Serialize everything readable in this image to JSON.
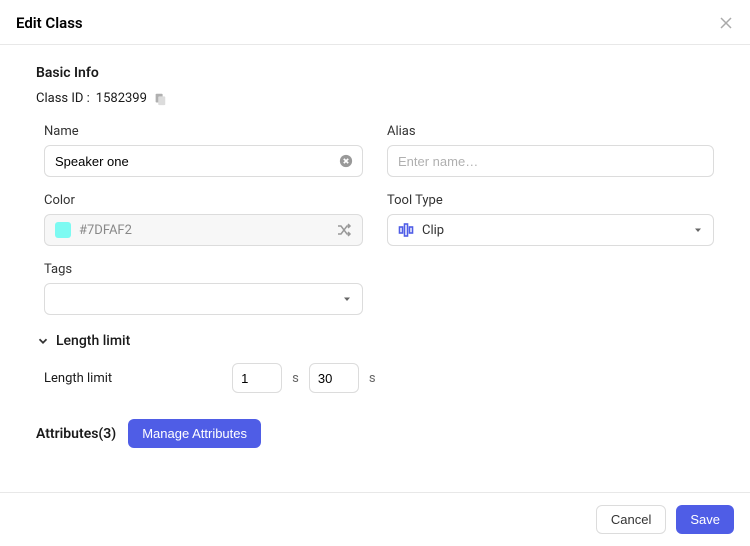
{
  "modal": {
    "title": "Edit Class"
  },
  "basic_info": {
    "section_title": "Basic Info",
    "class_id_label": "Class ID :",
    "class_id_value": "1582399",
    "name": {
      "label": "Name",
      "value": "Speaker one"
    },
    "alias": {
      "label": "Alias",
      "placeholder": "Enter name…"
    },
    "color": {
      "label": "Color",
      "hex": "#7DFAF2"
    },
    "tool_type": {
      "label": "Tool Type",
      "value": "Clip"
    },
    "tags": {
      "label": "Tags"
    }
  },
  "length": {
    "header": "Length limit",
    "label": "Length limit",
    "min": "1",
    "max": "30",
    "unit": "s"
  },
  "attributes": {
    "title": "Attributes(3)",
    "manage_label": "Manage Attributes"
  },
  "footer": {
    "cancel": "Cancel",
    "save": "Save"
  }
}
